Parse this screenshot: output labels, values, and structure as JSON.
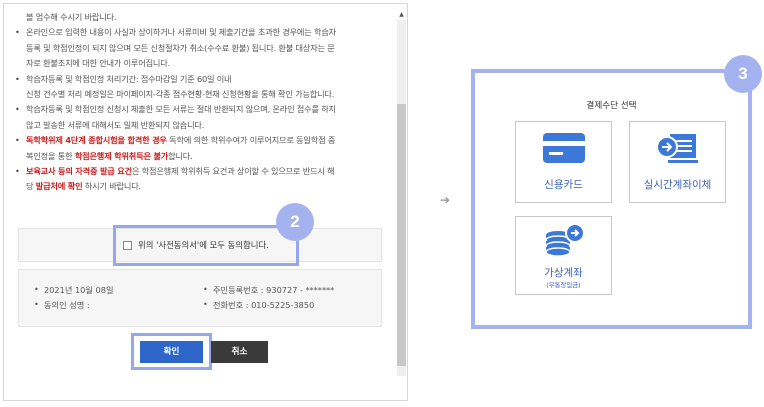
{
  "notice": {
    "lines": [
      {
        "type": "cont",
        "text": "볼 엄수해 수시기 바랍니다."
      },
      {
        "type": "bullet",
        "text": "온라인으로 입력한 내용이 사실과 상이하거나 서류미비 및 제출기간을 초과한 경우에는 학습자"
      },
      {
        "type": "cont",
        "text": "등록 및 학점인정이 되지 않으며 모든 신청절차가 취소(수수료 환불) 됩니다. 환불 대상자는 문"
      },
      {
        "type": "cont",
        "text": "자로 환불조치에 대한 안내가 이루어집니다."
      },
      {
        "type": "bullet",
        "text": "학습자등록 및 학점인정 처리기간: 접수마감일 기준 60일 이내"
      },
      {
        "type": "cont",
        "text": "신청 건수별 처리 예정일은 마이페이지-각종 접수현황-현재 신청현황을 통해 확인 가능합니다."
      },
      {
        "type": "bullet",
        "text": "학습자등록 및 학점인정 신청시 제출한 모든 서류는 절대 반환되지 않으며, 온라인 접수를 하지"
      },
      {
        "type": "cont",
        "text": "않고 발송한 서류에 대해서도 일체 반환되지 않습니다."
      }
    ],
    "red1": {
      "a": "독학학위제 4단계 종합시험을 합격한 경우",
      "b": " 독학에 의한 학위수여가 이루어지므로 동일학점 중",
      "c": "복인정을 통한 ",
      "d": "학점은행제 학위취득은 불가",
      "e": "합니다."
    },
    "red2": {
      "a": "보육교사 등의 자격증 발급 요건",
      "b": "은 학점은행제 학위취득 요건과 상이할 수 있으므로 반드시 해",
      "c": "당 ",
      "d": "발급처에 확인",
      "e": " 하시기 바랍니다."
    }
  },
  "agree": {
    "label": "위의 '사전동의서'에 모두 동의합니다."
  },
  "info": {
    "date": "2021년 10월 08일",
    "signer": "동의인 성명 :",
    "resident_no": "주민등록번호 : 930727 - *******",
    "phone": "전화번호 : 010-5225-3850"
  },
  "buttons": {
    "confirm": "확인",
    "cancel": "취소"
  },
  "steps": {
    "two": "2",
    "three": "3"
  },
  "arrow": "➔",
  "payment": {
    "title": "결제수단 선택",
    "credit_card": "신용카드",
    "realtime_transfer": "실시간계좌이체",
    "virtual_account": "가상계좌",
    "virtual_account_sub": "(무통장입금)"
  },
  "colors": {
    "accent": "#a4b2f0",
    "primary": "#2e65c9",
    "red": "#c8201f",
    "icon_blue": "#3c78d8"
  }
}
